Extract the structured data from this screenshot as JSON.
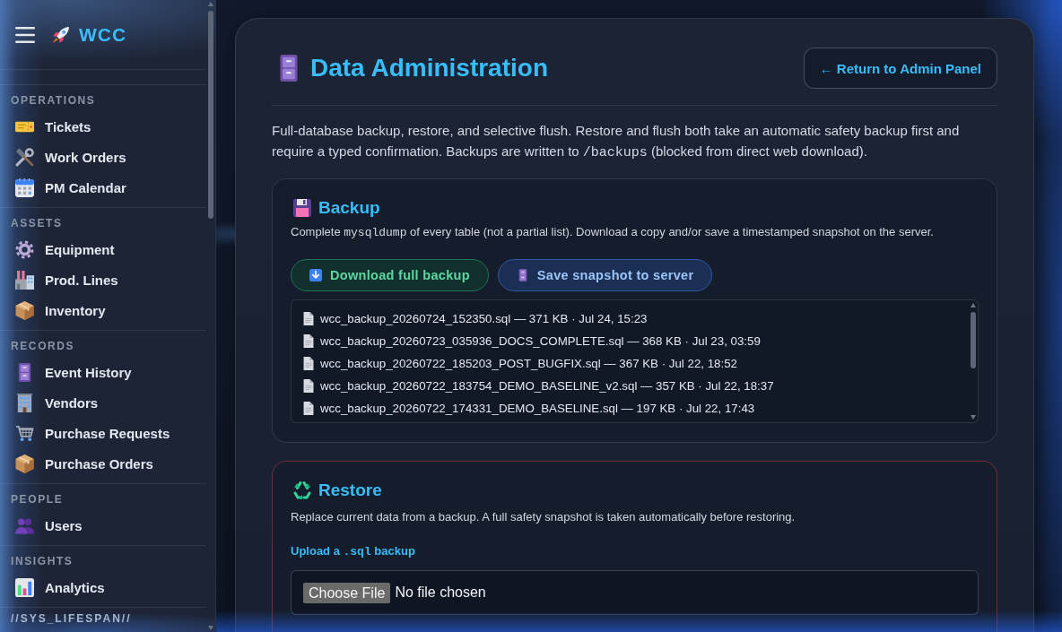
{
  "sidebar": {
    "brand": "WCC",
    "sections": [
      {
        "label": "OPERATIONS",
        "items": [
          {
            "label": "Tickets",
            "selected": false
          },
          {
            "label": "Work Orders",
            "selected": false
          },
          {
            "label": "PM Calendar",
            "selected": false
          }
        ]
      },
      {
        "label": "ASSETS",
        "items": [
          {
            "label": "Equipment",
            "selected": false
          },
          {
            "label": "Prod. Lines",
            "selected": false
          },
          {
            "label": "Inventory",
            "selected": false
          }
        ]
      },
      {
        "label": "RECORDS",
        "items": [
          {
            "label": "Event History",
            "selected": false
          },
          {
            "label": "Vendors",
            "selected": false
          },
          {
            "label": "Purchase Requests",
            "selected": false
          },
          {
            "label": "Purchase Orders",
            "selected": false
          }
        ]
      },
      {
        "label": "PEOPLE",
        "items": [
          {
            "label": "Users",
            "selected": false
          }
        ]
      },
      {
        "label": "INSIGHTS",
        "items": [
          {
            "label": "Analytics",
            "selected": false
          }
        ]
      }
    ],
    "footer": "//SYS_LIFESPAN//"
  },
  "page": {
    "title": "Data Administration",
    "back_button": "← Return to Admin Panel",
    "description": [
      {
        "kind": "text",
        "text": "Full-database backup, restore, and selective flush. Restore and flush both take an automatic safety backup first and require a typed confirmation. Backups are written to "
      },
      {
        "kind": "code",
        "text": "/backups"
      },
      {
        "kind": "text",
        "text": " (blocked from direct web download)."
      }
    ]
  },
  "backup": {
    "title": "Backup",
    "description": [
      {
        "kind": "text",
        "text": "Complete "
      },
      {
        "kind": "code",
        "text": "mysqldump"
      },
      {
        "kind": "text",
        "text": " of every table (not a partial list). Download a copy and/or save a timestamped snapshot on the server."
      }
    ],
    "buttons": [
      {
        "label": "Download full backup",
        "kind": "success"
      },
      {
        "label": "Save snapshot to server",
        "kind": "primary"
      }
    ],
    "files": [
      {
        "label": "wcc_backup_20260724_152350.sql — 371 KB · Jul 24, 15:23"
      },
      {
        "label": "wcc_backup_20260723_035936_DOCS_COMPLETE.sql — 368 KB · Jul 23, 03:59"
      },
      {
        "label": "wcc_backup_20260722_185203_POST_BUGFIX.sql — 367 KB · Jul 22, 18:52"
      },
      {
        "label": "wcc_backup_20260722_183754_DEMO_BASELINE_v2.sql — 357 KB · Jul 22, 18:37"
      },
      {
        "label": "wcc_backup_20260722_174331_DEMO_BASELINE.sql — 197 KB · Jul 22, 17:43"
      }
    ]
  },
  "restore": {
    "title": "Restore",
    "description": "Replace current data from a backup. A full safety snapshot is taken automatically before restoring.",
    "upload_label": [
      {
        "kind": "text",
        "text": "Upload a "
      },
      {
        "kind": "code",
        "text": ".sql"
      },
      {
        "kind": "text",
        "text": " backup"
      }
    ],
    "file_input": {
      "button": "Choose File",
      "status": "No file chosen"
    }
  }
}
